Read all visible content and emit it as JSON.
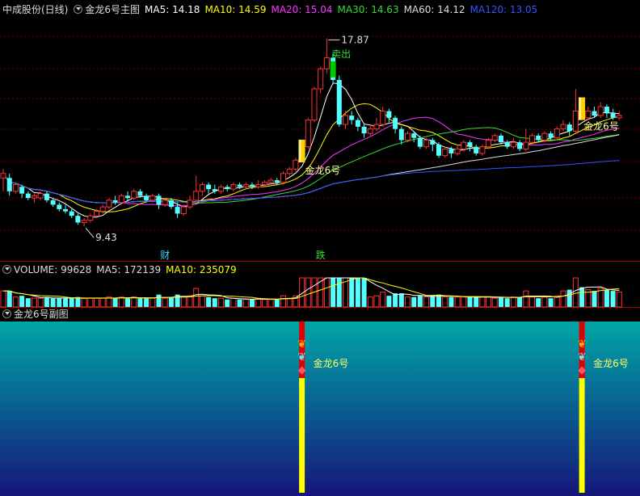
{
  "main": {
    "stock_title": "中成股份(日线)",
    "indicator_name": "金龙6号主图",
    "ma": [
      {
        "label": "MA5: 14.18",
        "color": "#ffffff"
      },
      {
        "label": "MA10: 14.59",
        "color": "#ffff00"
      },
      {
        "label": "MA20: 15.04",
        "color": "#ff33ff"
      },
      {
        "label": "MA30: 14.63",
        "color": "#33dd33"
      },
      {
        "label": "MA60: 14.12",
        "color": "#dddddd"
      },
      {
        "label": "MA120: 13.05",
        "color": "#3355ff"
      }
    ],
    "high_label": "17.87",
    "low_label": "9.43",
    "sell_label": "卖出",
    "signal_label": "金龙6号",
    "event_cai": "财",
    "event_die": "跌"
  },
  "volume": {
    "label": "VOLUME: 99628",
    "ma5": "MA5: 172139",
    "ma10": "MA10: 235079"
  },
  "sub": {
    "title": "金龙6号副图",
    "signal_label": "金龙6号"
  },
  "colors": {
    "up": "#ff3232",
    "down": "#54ffff",
    "grid": "#8b0000",
    "signal_gold": "#ffd000",
    "sell_green": "#00c800"
  },
  "chart_data": {
    "type": "candlestick",
    "ylim": [
      9.0,
      18.5
    ],
    "candles": [
      [
        11.6,
        11.8,
        12.0,
        11.0
      ],
      [
        11.6,
        11.0,
        11.8,
        10.8
      ],
      [
        11.0,
        11.3,
        11.4,
        10.9
      ],
      [
        11.2,
        10.9,
        11.3,
        10.7
      ],
      [
        10.9,
        10.7,
        11.0,
        10.6
      ],
      [
        10.7,
        10.8,
        10.9,
        10.5
      ],
      [
        10.7,
        10.9,
        11.0,
        10.6
      ],
      [
        10.9,
        10.6,
        11.0,
        10.5
      ],
      [
        10.6,
        10.4,
        10.7,
        10.3
      ],
      [
        10.4,
        10.2,
        10.5,
        10.1
      ],
      [
        10.2,
        10.1,
        10.4,
        10.0
      ],
      [
        10.1,
        9.9,
        10.2,
        9.8
      ],
      [
        9.9,
        9.6,
        10.0,
        9.5
      ],
      [
        9.6,
        9.7,
        9.8,
        9.43
      ],
      [
        9.7,
        9.9,
        10.0,
        9.6
      ],
      [
        9.9,
        10.1,
        10.2,
        9.8
      ],
      [
        10.1,
        10.3,
        10.4,
        10.0
      ],
      [
        10.3,
        10.6,
        10.7,
        10.2
      ],
      [
        10.6,
        10.5,
        10.8,
        10.4
      ],
      [
        10.5,
        10.8,
        10.9,
        10.4
      ],
      [
        10.8,
        10.7,
        11.0,
        10.6
      ],
      [
        10.7,
        11.0,
        11.1,
        10.6
      ],
      [
        11.0,
        10.8,
        11.1,
        10.7
      ],
      [
        10.8,
        10.6,
        10.9,
        10.5
      ],
      [
        10.6,
        10.8,
        10.9,
        10.5
      ],
      [
        10.8,
        10.4,
        10.9,
        10.2
      ],
      [
        10.4,
        10.6,
        10.7,
        10.3
      ],
      [
        10.6,
        10.3,
        10.7,
        10.2
      ],
      [
        10.3,
        10.0,
        10.5,
        9.8
      ],
      [
        10.0,
        10.3,
        10.4,
        9.9
      ],
      [
        10.3,
        10.6,
        10.8,
        10.2
      ],
      [
        10.6,
        11.0,
        11.7,
        10.5
      ],
      [
        11.0,
        11.3,
        11.4,
        10.8
      ],
      [
        11.3,
        11.1,
        11.4,
        10.9
      ],
      [
        11.1,
        11.0,
        11.3,
        10.9
      ],
      [
        11.0,
        11.2,
        11.3,
        10.9
      ],
      [
        11.2,
        11.1,
        11.3,
        11.0
      ],
      [
        11.1,
        11.3,
        11.4,
        11.0
      ],
      [
        11.3,
        11.2,
        11.4,
        11.1
      ],
      [
        11.2,
        11.3,
        11.4,
        11.1
      ],
      [
        11.3,
        11.2,
        11.4,
        11.1
      ],
      [
        11.2,
        11.3,
        11.5,
        11.1
      ],
      [
        11.3,
        11.4,
        11.5,
        11.2
      ],
      [
        11.4,
        11.5,
        11.6,
        11.3
      ],
      [
        11.5,
        11.4,
        11.6,
        11.3
      ],
      [
        11.4,
        11.8,
        11.9,
        11.3
      ],
      [
        11.8,
        12.0,
        12.1,
        11.7
      ],
      [
        12.0,
        12.4,
        12.5,
        11.9
      ],
      [
        12.4,
        13.0,
        13.1,
        12.3
      ],
      [
        13.0,
        14.2,
        14.3,
        12.9
      ],
      [
        14.2,
        15.6,
        15.7,
        14.1
      ],
      [
        15.6,
        16.5,
        16.6,
        15.4
      ],
      [
        16.5,
        17.0,
        17.87,
        16.3
      ],
      [
        17.0,
        16.0,
        17.2,
        15.8
      ],
      [
        16.0,
        14.0,
        16.2,
        13.9
      ],
      [
        14.0,
        14.4,
        14.6,
        13.8
      ],
      [
        14.4,
        14.2,
        14.6,
        14.0
      ],
      [
        14.2,
        13.9,
        14.3,
        13.7
      ],
      [
        13.9,
        13.6,
        14.0,
        13.4
      ],
      [
        13.6,
        13.8,
        14.0,
        13.5
      ],
      [
        13.8,
        14.0,
        14.3,
        13.7
      ],
      [
        14.0,
        14.6,
        14.8,
        13.9
      ],
      [
        14.6,
        14.3,
        14.7,
        14.1
      ],
      [
        14.3,
        13.8,
        14.4,
        13.6
      ],
      [
        13.8,
        13.3,
        13.9,
        13.1
      ],
      [
        13.3,
        13.6,
        13.7,
        13.2
      ],
      [
        13.6,
        13.4,
        13.7,
        13.2
      ],
      [
        13.4,
        13.0,
        13.5,
        12.9
      ],
      [
        13.0,
        13.3,
        13.4,
        12.9
      ],
      [
        13.3,
        13.1,
        13.4,
        12.8
      ],
      [
        13.1,
        12.6,
        13.2,
        12.5
      ],
      [
        12.6,
        12.9,
        13.0,
        12.5
      ],
      [
        12.9,
        12.7,
        13.0,
        12.5
      ],
      [
        12.7,
        12.9,
        13.1,
        12.6
      ],
      [
        12.9,
        13.2,
        13.3,
        12.8
      ],
      [
        13.2,
        13.0,
        13.3,
        12.8
      ],
      [
        13.0,
        12.7,
        13.1,
        12.6
      ],
      [
        12.7,
        13.0,
        13.1,
        12.6
      ],
      [
        13.0,
        13.3,
        13.4,
        12.9
      ],
      [
        13.3,
        13.5,
        13.6,
        13.2
      ],
      [
        13.5,
        13.2,
        13.6,
        13.1
      ],
      [
        13.2,
        13.0,
        13.3,
        12.9
      ],
      [
        13.0,
        13.2,
        13.4,
        12.9
      ],
      [
        13.2,
        12.9,
        13.3,
        12.8
      ],
      [
        12.9,
        13.2,
        13.8,
        12.8
      ],
      [
        13.2,
        13.5,
        13.6,
        13.1
      ],
      [
        13.5,
        13.3,
        13.6,
        13.2
      ],
      [
        13.3,
        13.6,
        13.7,
        13.2
      ],
      [
        13.6,
        13.4,
        13.7,
        13.3
      ],
      [
        13.4,
        13.8,
        13.9,
        13.3
      ],
      [
        13.8,
        14.0,
        14.2,
        13.7
      ],
      [
        14.0,
        13.7,
        14.1,
        13.5
      ],
      [
        13.7,
        14.6,
        15.6,
        13.6
      ],
      [
        14.6,
        14.3,
        15.0,
        14.2
      ],
      [
        14.3,
        14.6,
        14.8,
        14.2
      ],
      [
        14.6,
        14.4,
        14.8,
        14.3
      ],
      [
        14.4,
        14.8,
        15.0,
        14.3
      ],
      [
        14.8,
        14.5,
        14.9,
        14.3
      ],
      [
        14.5,
        14.3,
        14.7,
        14.2
      ],
      [
        14.3,
        14.4,
        14.6,
        14.2
      ]
    ],
    "signal_bars": [
      48,
      93
    ],
    "sell_bar": 53
  }
}
